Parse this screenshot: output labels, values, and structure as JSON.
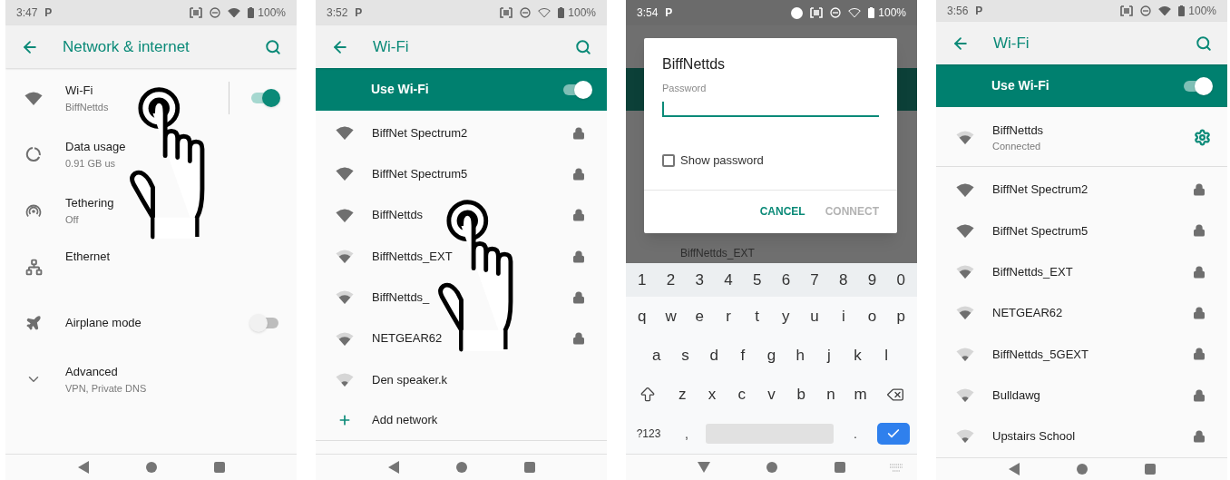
{
  "screens": [
    {
      "kind": "settings",
      "status": {
        "time": "3:47",
        "app_icon": "P",
        "battery": "100%",
        "wifi_connected": true,
        "record_dot": false
      },
      "title": "Network & internet",
      "touch_overlay": true,
      "keyboard_open": false,
      "items": [
        {
          "kind": "wifi",
          "title": "Wi-Fi",
          "subtitle": "BiffNettds",
          "on": true
        },
        {
          "kind": "data",
          "title": "Data usage",
          "subtitle": "0.91 GB us"
        },
        {
          "kind": "tethering",
          "title": "Tethering",
          "subtitle": "Off"
        },
        {
          "kind": "ethernet",
          "title": "Ethernet"
        },
        {
          "kind": "airplane",
          "title": "Airplane mode",
          "on": false
        },
        {
          "kind": "expand",
          "title": "Advanced",
          "subtitle": "VPN, Private DNS"
        }
      ]
    },
    {
      "kind": "wifi_list",
      "status": {
        "time": "3:52",
        "app_icon": "P",
        "battery": "100%",
        "wifi_connected": false,
        "record_dot": false
      },
      "title": "Wi-Fi",
      "touch_overlay": true,
      "keyboard_open": false,
      "use_wifi": {
        "label": "Use Wi-Fi",
        "on": true
      },
      "networks": [
        {
          "name": "BiffNet Spectrum2",
          "kind": "full",
          "locked": true
        },
        {
          "name": "BiffNet Spectrum5",
          "kind": "full",
          "locked": true
        },
        {
          "name": "BiffNettds",
          "kind": "full",
          "locked": true
        },
        {
          "name": "BiffNettds_EXT",
          "kind": "medium",
          "locked": true
        },
        {
          "name": "BiffNettds_",
          "kind": "medium",
          "locked": true
        },
        {
          "name": "NETGEAR62",
          "kind": "medium",
          "locked": true
        },
        {
          "name": "Den speaker.k",
          "kind": "low",
          "locked": false
        }
      ],
      "add_network": "Add network"
    },
    {
      "kind": "dialog",
      "status": {
        "time": "3:54",
        "app_icon": "P",
        "battery": "100%",
        "wifi_connected": false,
        "record_dot": true
      },
      "touch_overlay": false,
      "keyboard_open": true,
      "background_row": "BiffNettds_EXT",
      "dialog": {
        "title": "BiffNettds",
        "field_label": "Password",
        "checkbox": {
          "label": "Show password",
          "checked": false
        },
        "buttons": [
          {
            "label": "CANCEL",
            "disabled": false
          },
          {
            "label": "CONNECT",
            "disabled": true
          }
        ]
      },
      "keyboard": {
        "numbers": [
          "1",
          "2",
          "3",
          "4",
          "5",
          "6",
          "7",
          "8",
          "9",
          "0"
        ],
        "rows": [
          [
            "q",
            "w",
            "e",
            "r",
            "t",
            "y",
            "u",
            "i",
            "o",
            "p"
          ],
          [
            "a",
            "s",
            "d",
            "f",
            "g",
            "h",
            "j",
            "k",
            "l"
          ],
          [
            "z",
            "x",
            "c",
            "v",
            "b",
            "n",
            "m"
          ]
        ],
        "symbols": "?123",
        "comma": ",",
        "period": "."
      }
    },
    {
      "kind": "wifi_list",
      "status": {
        "time": "3:56",
        "app_icon": "P",
        "battery": "100%",
        "wifi_connected": true,
        "record_dot": false
      },
      "title": "Wi-Fi",
      "touch_overlay": false,
      "keyboard_open": false,
      "use_wifi": {
        "label": "Use Wi-Fi",
        "on": true
      },
      "connected": {
        "name": "BiffNettds",
        "status": "Connected"
      },
      "networks": [
        {
          "name": "BiffNet Spectrum2",
          "kind": "full",
          "locked": true
        },
        {
          "name": "BiffNet Spectrum5",
          "kind": "full",
          "locked": true
        },
        {
          "name": "BiffNettds_EXT",
          "kind": "medium",
          "locked": true
        },
        {
          "name": "NETGEAR62",
          "kind": "medium",
          "locked": true
        },
        {
          "name": "BiffNettds_5GEXT",
          "kind": "low",
          "locked": true
        },
        {
          "name": "Bulldawg",
          "kind": "low",
          "locked": true
        },
        {
          "name": "Upstairs School",
          "kind": "low",
          "locked": true
        }
      ]
    }
  ]
}
